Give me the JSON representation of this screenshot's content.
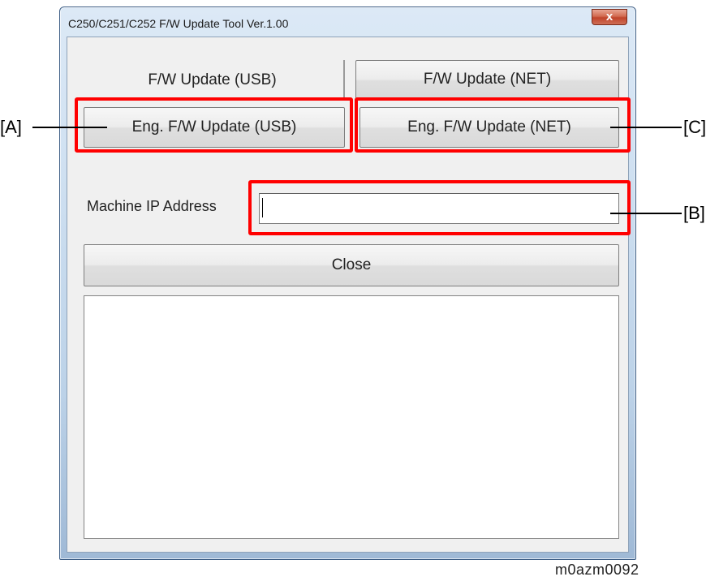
{
  "window": {
    "title": "C250/C251/C252 F/W Update Tool Ver.1.00",
    "close_glyph": "x"
  },
  "buttons": {
    "fw_update_usb": "F/W Update (USB)",
    "fw_update_net": "F/W Update (NET)",
    "eng_fw_update_usb": "Eng. F/W Update (USB)",
    "eng_fw_update_net": "Eng. F/W Update (NET)",
    "close": "Close"
  },
  "ip": {
    "label": "Machine IP Address",
    "value": ""
  },
  "callouts": {
    "a": "[A]",
    "b": "[B]",
    "c": "[C]"
  },
  "figure_id": "m0azm0092",
  "colors": {
    "highlight": "#ff0000",
    "window_frame": "#bcd2e8",
    "close_button": "#c0432a"
  }
}
